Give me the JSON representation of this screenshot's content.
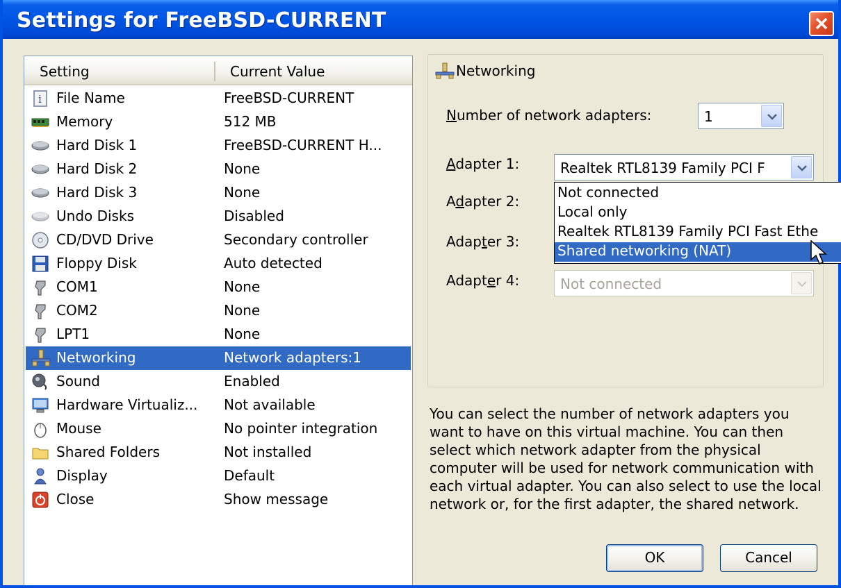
{
  "window": {
    "title": "Settings for FreeBSD-CURRENT"
  },
  "list": {
    "header_setting": "Setting",
    "header_value": "Current Value",
    "rows": [
      {
        "name": "File Name",
        "value": "FreeBSD-CURRENT",
        "icon": "file-info-icon"
      },
      {
        "name": "Memory",
        "value": "512 MB",
        "icon": "memory-icon"
      },
      {
        "name": "Hard Disk 1",
        "value": "FreeBSD-CURRENT H...",
        "icon": "hard-disk-icon"
      },
      {
        "name": "Hard Disk 2",
        "value": "None",
        "icon": "hard-disk-icon"
      },
      {
        "name": "Hard Disk 3",
        "value": "None",
        "icon": "hard-disk-icon"
      },
      {
        "name": "Undo Disks",
        "value": "Disabled",
        "icon": "undo-disk-icon"
      },
      {
        "name": "CD/DVD Drive",
        "value": "Secondary controller",
        "icon": "cd-dvd-icon"
      },
      {
        "name": "Floppy Disk",
        "value": "Auto detected",
        "icon": "floppy-icon"
      },
      {
        "name": "COM1",
        "value": "None",
        "icon": "com-port-icon"
      },
      {
        "name": "COM2",
        "value": "None",
        "icon": "com-port-icon"
      },
      {
        "name": "LPT1",
        "value": "None",
        "icon": "lpt-port-icon"
      },
      {
        "name": "Networking",
        "value": "Network adapters:1",
        "icon": "network-icon"
      },
      {
        "name": "Sound",
        "value": "Enabled",
        "icon": "sound-icon"
      },
      {
        "name": "Hardware Virtualiz...",
        "value": "Not available",
        "icon": "hardware-virtualization-icon"
      },
      {
        "name": "Mouse",
        "value": "No pointer integration",
        "icon": "mouse-icon"
      },
      {
        "name": "Shared Folders",
        "value": "Not installed",
        "icon": "folder-icon"
      },
      {
        "name": "Display",
        "value": "Default",
        "icon": "display-icon"
      },
      {
        "name": "Close",
        "value": "Show message",
        "icon": "close-power-icon"
      }
    ],
    "selected_index": 11
  },
  "networking": {
    "group_title": "Networking",
    "num_adapters_label_pre": "",
    "num_adapters_label_u": "N",
    "num_adapters_label_post": "umber of network adapters:",
    "num_adapters_value": "1",
    "adapter1_label_pre": "",
    "adapter1_label_u": "A",
    "adapter1_label_post": "dapter 1:",
    "adapter1_value": "Realtek RTL8139 Family PCI F",
    "adapter2_label_pre": "A",
    "adapter2_label_u": "d",
    "adapter2_label_post": "apter 2:",
    "adapter3_label_pre": "Adap",
    "adapter3_label_u": "t",
    "adapter3_label_post": "er 3:",
    "adapter4_label_pre": "Adapt",
    "adapter4_label_u": "e",
    "adapter4_label_post": "r 4:",
    "adapter4_value": "Not connected",
    "dropdown_options": [
      "Not connected",
      "Local only",
      "Realtek RTL8139 Family PCI Fast Ethe",
      "Shared networking (NAT)"
    ],
    "dropdown_selected_index": 3
  },
  "description": "You can select the number of network adapters you want to have on this virtual machine. You can then select which network adapter from the physical computer will be used for network communication with each virtual adapter. You can also select to use the local network or, for the first adapter, the shared network.",
  "buttons": {
    "ok": "OK",
    "cancel": "Cancel"
  },
  "colors": {
    "title_bar": "#0055e5",
    "selection": "#316ac5",
    "dialog_bg": "#ece9d8"
  }
}
